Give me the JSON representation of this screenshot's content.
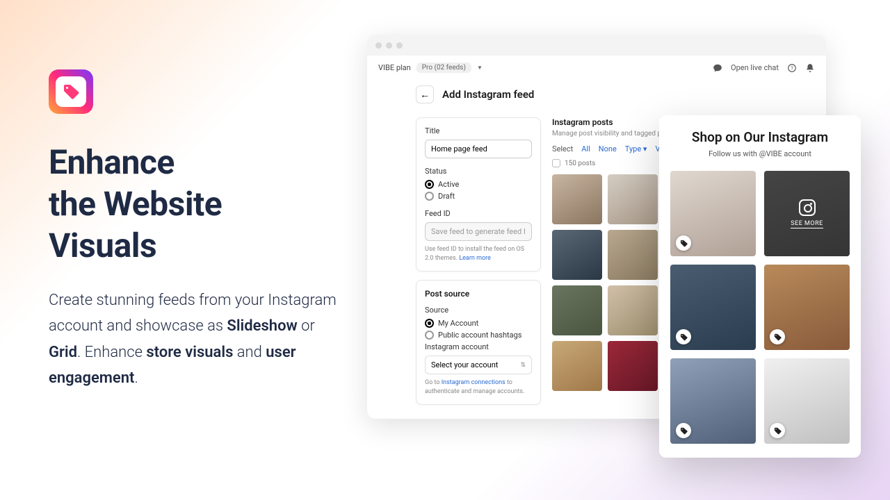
{
  "hero": {
    "headline_l1": "Enhance",
    "headline_l2": "the Website",
    "headline_l3": "Visuals",
    "sub_p1": "Create stunning feeds from your Instagram account and showcase as ",
    "sub_b1": "Slideshow",
    "sub_p2": " or ",
    "sub_b2": "Grid",
    "sub_p3": ". Enhance ",
    "sub_b3": "store visuals",
    "sub_p4": " and ",
    "sub_b4": "user engagement",
    "sub_p5": "."
  },
  "topbar": {
    "brand": "VIBE plan",
    "plan": "Pro (02 feeds)",
    "chat": "Open live chat"
  },
  "page": {
    "title": "Add Instagram feed"
  },
  "form": {
    "title_label": "Title",
    "title_value": "Home page feed",
    "status_label": "Status",
    "status_active": "Active",
    "status_draft": "Draft",
    "feedid_label": "Feed ID",
    "feedid_placeholder": "Save feed to generate feed ID",
    "feedid_help_pre": "Use feed ID to install the feed on OS 2.0 themes. ",
    "feedid_help_link": "Learn more",
    "postsource_title": "Post source",
    "source_label": "Source",
    "source_my": "My Account",
    "source_pub": "Public account hashtags",
    "account_label": "Instagram account",
    "account_select": "Select your account",
    "account_help_pre": "Go to ",
    "account_help_link": "Instagram connections",
    "account_help_post": " to authenticate and manage accounts."
  },
  "posts": {
    "title": "Instagram posts",
    "subtitle": "Manage post visibility and tagged products",
    "select": "Select",
    "all": "All",
    "none": "None",
    "type": "Type",
    "visib": "Visib",
    "count": "150 posts"
  },
  "preview": {
    "title": "Shop on Our Instagram",
    "subtitle": "Follow us with @VIBE account",
    "see_more": "SEE MORE"
  }
}
